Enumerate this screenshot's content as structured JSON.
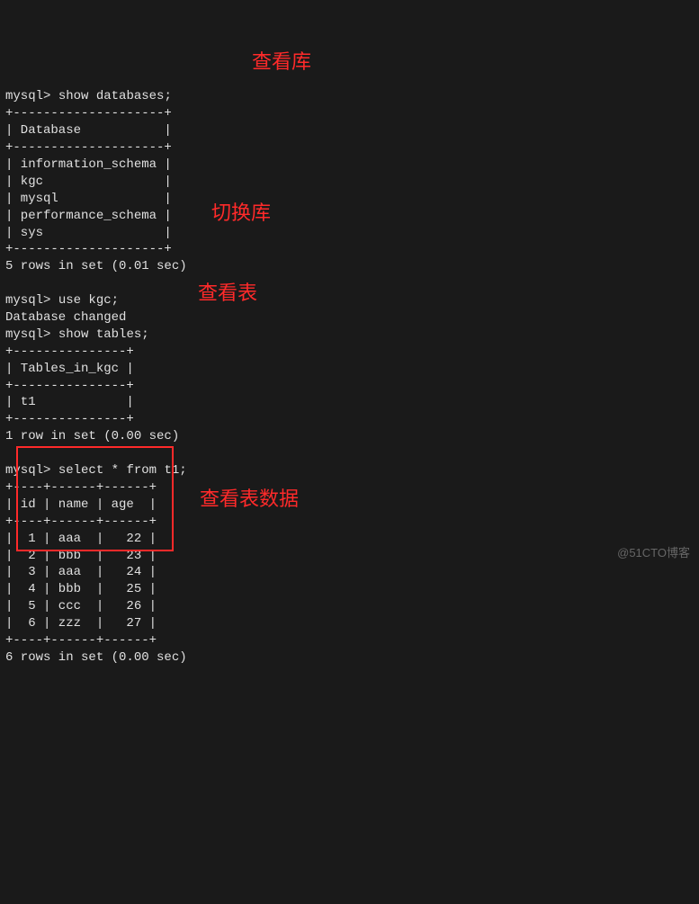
{
  "terminal": {
    "prompt": "mysql>",
    "cmd_show_db": "show databases;",
    "h1_border": "+--------------------+",
    "h1_header": "| Database           |",
    "db_rows": [
      "| information_schema |",
      "| kgc                |",
      "| mysql              |",
      "| performance_schema |",
      "| sys                |"
    ],
    "db_footer": "5 rows in set (0.01 sec)",
    "cmd_use": "use kgc;",
    "use_response": "Database changed",
    "cmd_show_tables": "show tables;",
    "t_border": "+---------------+",
    "t_header": "| Tables_in_kgc |",
    "t_rows": [
      "| t1            |"
    ],
    "t_footer": "1 row in set (0.00 sec)",
    "cmd_select": "select * from t1;",
    "s_border": "+----+------+------+",
    "s_header": "| id | name | age  |",
    "s_rows": [
      "|  1 | aaa  |   22 |",
      "|  2 | bbb  |   23 |",
      "|  3 | aaa  |   24 |",
      "|  4 | bbb  |   25 |",
      "|  5 | ccc  |   26 |",
      "|  6 | zzz  |   27 |"
    ],
    "s_footer": "6 rows in set (0.00 sec)"
  },
  "annotations": {
    "view_db": "查看库",
    "switch_db": "切换库",
    "view_tables": "查看表",
    "view_data": "查看表数据"
  },
  "watermark": "@51CTO博客",
  "chart_data": {
    "type": "table",
    "title": "t1",
    "columns": [
      "id",
      "name",
      "age"
    ],
    "rows": [
      [
        1,
        "aaa",
        22
      ],
      [
        2,
        "bbb",
        23
      ],
      [
        3,
        "aaa",
        24
      ],
      [
        4,
        "bbb",
        25
      ],
      [
        5,
        "ccc",
        26
      ],
      [
        6,
        "zzz",
        27
      ]
    ]
  }
}
